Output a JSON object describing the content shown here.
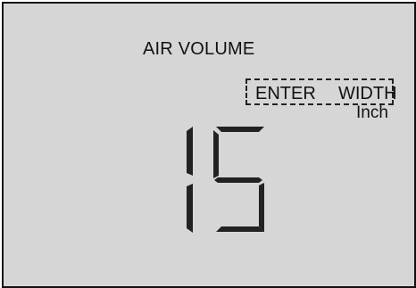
{
  "display": {
    "title": "AIR VOLUME",
    "prompt": {
      "enter": "ENTER",
      "field": "WIDTH"
    },
    "unit": "Inch",
    "value": "15"
  },
  "colors": {
    "background": "#d6d6d6",
    "foreground": "#111111",
    "outer": "#ffffff"
  }
}
